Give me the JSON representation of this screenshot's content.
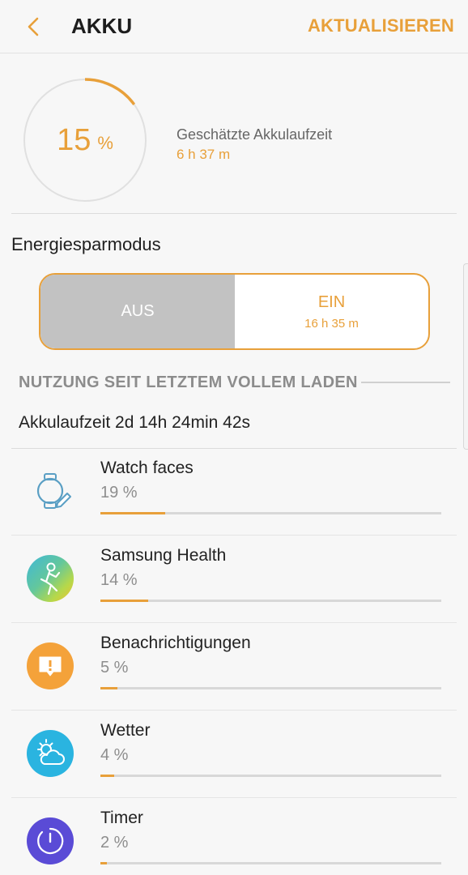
{
  "header": {
    "title": "AKKU",
    "refresh_label": "AKTUALISIEREN",
    "back_icon": "chevron-left-icon"
  },
  "battery": {
    "level_number": "15",
    "level_unit": "%",
    "level_fraction": 0.15,
    "estimate_label": "Geschätzte Akkulaufzeit",
    "estimate_value": "6 h 37 m"
  },
  "power_saving": {
    "title": "Energiesparmodus",
    "off_label": "AUS",
    "on_label": "EIN",
    "on_sub": "16 h 35 m",
    "selected": "AUS"
  },
  "usage": {
    "heading": "NUTZUNG SEIT LETZTEM VOLLEM LADEN",
    "runtime": "Akkulaufzeit 2d 14h 24min 42s",
    "apps": [
      {
        "name": "Watch faces",
        "percent": "19 %",
        "fraction": 0.19,
        "icon": "watch-edit-icon"
      },
      {
        "name": "Samsung Health",
        "percent": "14 %",
        "fraction": 0.14,
        "icon": "health-runner-icon"
      },
      {
        "name": "Benachrichtigungen",
        "percent": "5 %",
        "fraction": 0.05,
        "icon": "notification-icon"
      },
      {
        "name": "Wetter",
        "percent": "4 %",
        "fraction": 0.04,
        "icon": "weather-icon"
      },
      {
        "name": "Timer",
        "percent": "2 %",
        "fraction": 0.02,
        "icon": "timer-icon"
      }
    ]
  },
  "colors": {
    "accent": "#e8a03a",
    "off_segment": "#c2c2c2",
    "background": "#f7f7f7"
  }
}
